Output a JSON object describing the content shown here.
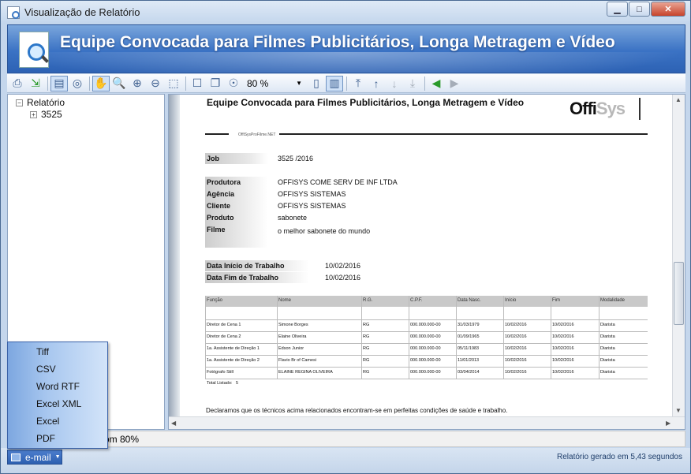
{
  "window": {
    "title": "Visualização de Relatório"
  },
  "banner": {
    "title": "Equipe Convocada para Filmes Publicitários, Longa Metragem e Vídeo"
  },
  "toolbar": {
    "zoom_value": "80 %"
  },
  "tree": {
    "root": "Relatório",
    "child": "3525"
  },
  "report": {
    "title": "Equipe Convocada para Filmes Publicitários, Longa Metragem e Vídeo",
    "logo_a": "Offi",
    "logo_b": "Sys",
    "sub_caption": "OffiSysProFilme.NET",
    "job_label": "Job",
    "job_value": "3525 /2016",
    "fields": [
      {
        "label": "Produtora",
        "value": "OFFISYS COME SERV DE INF LTDA"
      },
      {
        "label": "Agência",
        "value": "OFFISYS SISTEMAS"
      },
      {
        "label": "Cliente",
        "value": "OFFISYS SISTEMAS"
      },
      {
        "label": "Produto",
        "value": "sabonete"
      },
      {
        "label": "Filme",
        "value": "o melhor sabonete do mundo"
      }
    ],
    "dates": [
      {
        "label": "Data Início de Trabalho",
        "value": "10/02/2016"
      },
      {
        "label": "Data Fim de Trabalho",
        "value": "10/02/2016"
      }
    ],
    "columns": [
      "Função",
      "Nome",
      "R.G.",
      "C.P.F.",
      "Data Nasc.",
      "Início",
      "Fim",
      "Modalidade"
    ],
    "rows": [
      [
        "Diretor de Cena 1",
        "Simone Borges",
        "RG",
        "000.000.000-00",
        "31/03/1979",
        "10/02/2016",
        "10/02/2016",
        "Diarista"
      ],
      [
        "Diretor de Cena 2",
        "Elaine Oliveira",
        "RG",
        "000.000.000-00",
        "01/09/1965",
        "10/02/2016",
        "10/02/2016",
        "Diarista"
      ],
      [
        "1a. Assistente de Direção 1",
        "Edson Junior",
        "RG",
        "000.000.000-00",
        "05/11/1983",
        "10/02/2016",
        "10/02/2016",
        "Diarista"
      ],
      [
        "1a. Assistente de Direção 2",
        "Flavio Br of Camesi",
        "RG",
        "000.000.000-00",
        "11/01/2013",
        "10/02/2016",
        "10/02/2016",
        "Diarista"
      ],
      [
        "Fotógrafo Still",
        "ELAINE REGINA OLIVEIRA",
        "RG",
        "000.000.000-00",
        "03/04/2014",
        "10/02/2016",
        "10/02/2016",
        "Diarista"
      ]
    ],
    "total_label": "Total Listado:",
    "total_value": "5",
    "declaration": "Declaramos que os técnicos acima relacionados encontram-se em perfeitas condições de saúde e trabalho."
  },
  "zoombar": {
    "text": "om 80%"
  },
  "status": {
    "email_label": "e-mail",
    "generated_text": "Relatório gerado em 5,43 segundos"
  },
  "export_menu": [
    "Tiff",
    "CSV",
    "Word RTF",
    "Excel XML",
    "Excel",
    "PDF"
  ]
}
